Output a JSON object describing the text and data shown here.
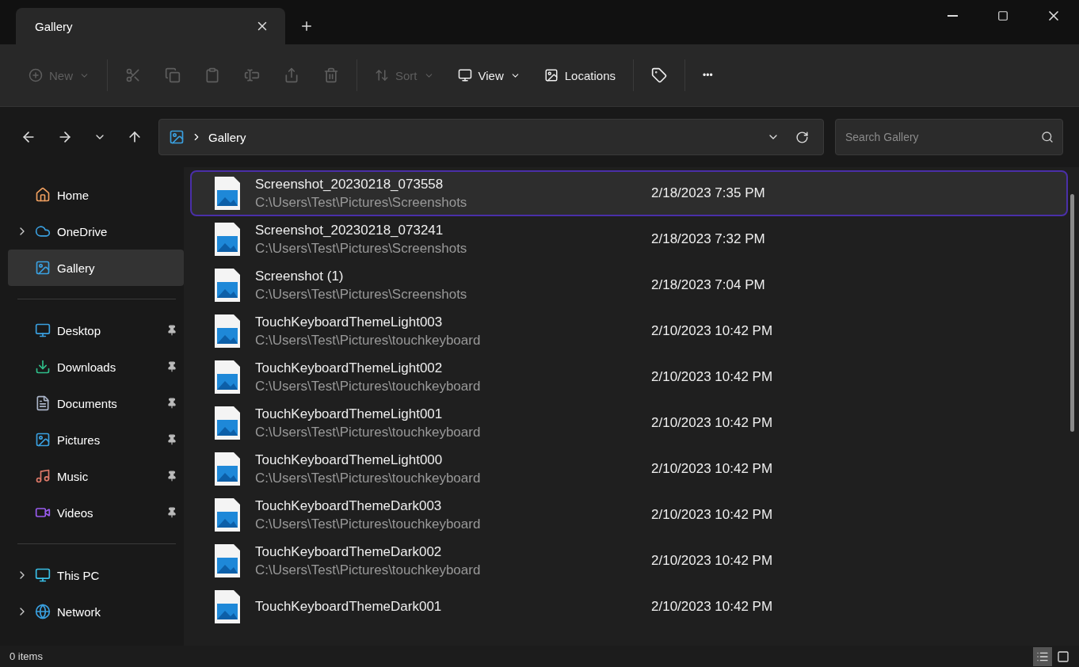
{
  "tabs": [
    {
      "label": "Gallery",
      "selected": true
    }
  ],
  "toolbar": [
    {
      "kind": "menu",
      "label": "New",
      "disabled": true
    },
    {
      "kind": "icon",
      "disabled": true
    },
    {
      "kind": "icon",
      "disabled": true
    },
    {
      "kind": "icon",
      "disabled": true
    },
    {
      "kind": "icon",
      "disabled": true
    },
    {
      "kind": "icon",
      "disabled": true
    },
    {
      "kind": "icon",
      "disabled": true
    },
    {
      "kind": "menu",
      "label": "Sort",
      "disabled": true
    },
    {
      "kind": "menu",
      "label": "View",
      "disabled": false
    },
    {
      "kind": "button",
      "label": "Locations",
      "disabled": false
    },
    {
      "kind": "icon",
      "disabled": false
    },
    {
      "kind": "more",
      "label": "•••",
      "disabled": false
    }
  ],
  "address": {
    "crumbs": [
      "Gallery"
    ]
  },
  "search": {
    "placeholder": "Search Gallery"
  },
  "sidebar": [
    [
      {
        "label": "Home",
        "expandable": false,
        "selected": false,
        "pinned": false
      },
      {
        "label": "OneDrive",
        "expandable": true,
        "selected": false,
        "pinned": false
      },
      {
        "label": "Gallery",
        "expandable": false,
        "selected": true,
        "pinned": false
      }
    ],
    [
      {
        "label": "Desktop",
        "expandable": false,
        "selected": false,
        "pinned": true
      },
      {
        "label": "Downloads",
        "expandable": false,
        "selected": false,
        "pinned": true
      },
      {
        "label": "Documents",
        "expandable": false,
        "selected": false,
        "pinned": true
      },
      {
        "label": "Pictures",
        "expandable": false,
        "selected": false,
        "pinned": true
      },
      {
        "label": "Music",
        "expandable": false,
        "selected": false,
        "pinned": true
      },
      {
        "label": "Videos",
        "expandable": false,
        "selected": false,
        "pinned": true
      }
    ],
    [
      {
        "label": "This PC",
        "expandable": true,
        "selected": false,
        "pinned": false
      },
      {
        "label": "Network",
        "expandable": true,
        "selected": false,
        "pinned": false
      }
    ]
  ],
  "files": [
    {
      "name": "Screenshot_20230218_073558",
      "path": "C:\\Users\\Test\\Pictures\\Screenshots",
      "date": "2/18/2023 7:35 PM",
      "selected": true
    },
    {
      "name": "Screenshot_20230218_073241",
      "path": "C:\\Users\\Test\\Pictures\\Screenshots",
      "date": "2/18/2023 7:32 PM",
      "selected": false
    },
    {
      "name": "Screenshot (1)",
      "path": "C:\\Users\\Test\\Pictures\\Screenshots",
      "date": "2/18/2023 7:04 PM",
      "selected": false
    },
    {
      "name": "TouchKeyboardThemeLight003",
      "path": "C:\\Users\\Test\\Pictures\\touchkeyboard",
      "date": "2/10/2023 10:42 PM",
      "selected": false
    },
    {
      "name": "TouchKeyboardThemeLight002",
      "path": "C:\\Users\\Test\\Pictures\\touchkeyboard",
      "date": "2/10/2023 10:42 PM",
      "selected": false
    },
    {
      "name": "TouchKeyboardThemeLight001",
      "path": "C:\\Users\\Test\\Pictures\\touchkeyboard",
      "date": "2/10/2023 10:42 PM",
      "selected": false
    },
    {
      "name": "TouchKeyboardThemeLight000",
      "path": "C:\\Users\\Test\\Pictures\\touchkeyboard",
      "date": "2/10/2023 10:42 PM",
      "selected": false
    },
    {
      "name": "TouchKeyboardThemeDark003",
      "path": "C:\\Users\\Test\\Pictures\\touchkeyboard",
      "date": "2/10/2023 10:42 PM",
      "selected": false
    },
    {
      "name": "TouchKeyboardThemeDark002",
      "path": "C:\\Users\\Test\\Pictures\\touchkeyboard",
      "date": "2/10/2023 10:42 PM",
      "selected": false
    },
    {
      "name": "TouchKeyboardThemeDark001",
      "date": "2/10/2023 10:42 PM",
      "selected": false
    }
  ],
  "status_bar": {
    "items": "0 items",
    "views": [
      {
        "kind": "details",
        "selected": true
      },
      {
        "kind": "tiles",
        "selected": false
      }
    ]
  }
}
